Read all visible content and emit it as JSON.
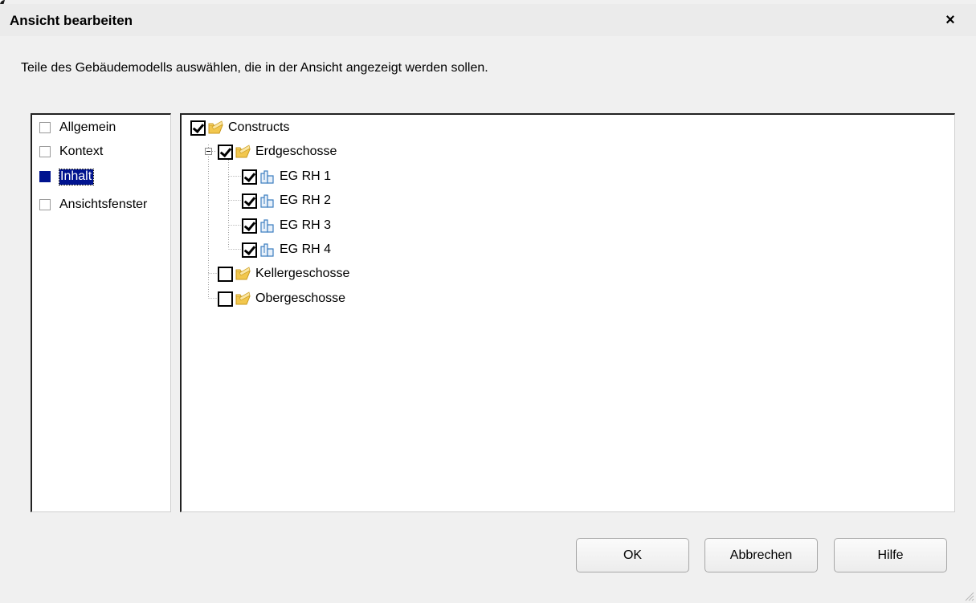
{
  "dialog": {
    "title": "Ansicht bearbeiten",
    "close_label": "×",
    "instruction": "Teile des Gebäudemodells auswählen, die in der Ansicht angezeigt werden sollen."
  },
  "categories": {
    "items": [
      {
        "label": "Allgemein",
        "selected": false
      },
      {
        "label": "Kontext",
        "selected": false
      },
      {
        "label": "Inhalt",
        "selected": true
      },
      {
        "label": "Ansichtsfenster",
        "selected": false
      }
    ]
  },
  "tree": {
    "root": {
      "label": "Constructs",
      "checked": true,
      "icon": "folder-icon"
    },
    "groups": [
      {
        "label": "Erdgeschosse",
        "checked": true,
        "expanded": true,
        "icon": "folder-icon",
        "children": [
          {
            "label": "EG RH 1",
            "checked": true,
            "icon": "building-part-icon"
          },
          {
            "label": "EG RH 2",
            "checked": true,
            "icon": "building-part-icon"
          },
          {
            "label": "EG RH 3",
            "checked": true,
            "icon": "building-part-icon"
          },
          {
            "label": "EG RH 4",
            "checked": true,
            "icon": "building-part-icon"
          }
        ]
      },
      {
        "label": "Kellergeschosse",
        "checked": false,
        "icon": "folder-icon"
      },
      {
        "label": "Obergeschosse",
        "checked": false,
        "icon": "folder-icon"
      }
    ]
  },
  "buttons": {
    "ok": "OK",
    "cancel": "Abbrechen",
    "help": "Hilfe"
  }
}
